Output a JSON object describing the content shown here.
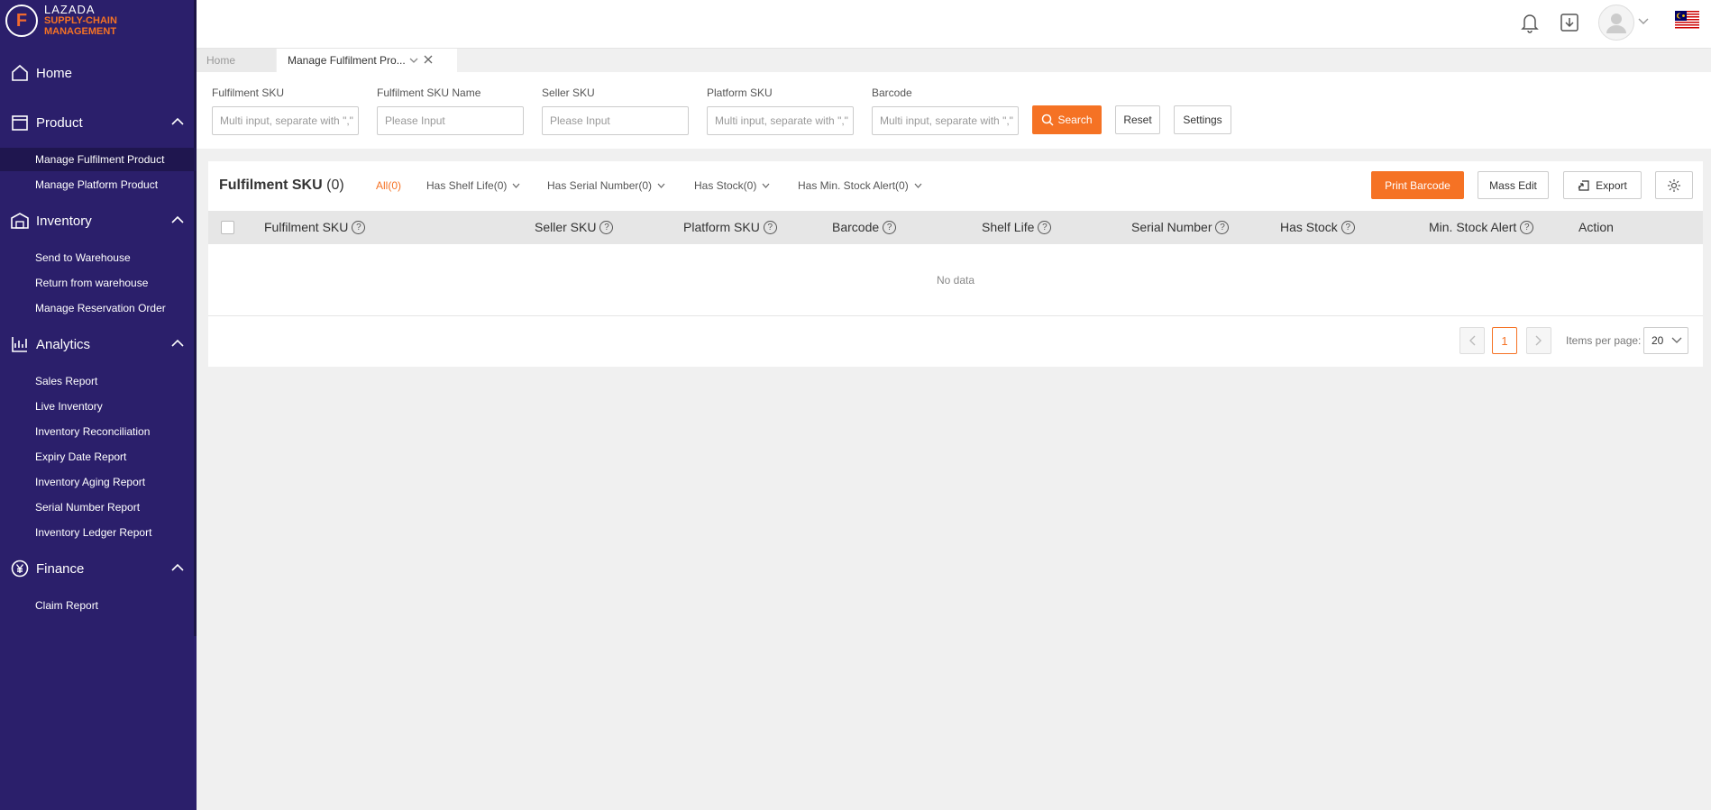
{
  "brand": {
    "line1": "LAZADA",
    "line2": "SUPPLY-CHAIN",
    "line3": "MANAGEMENT",
    "mark": "F",
    "accent": "#f57224"
  },
  "sidebar": {
    "home": "Home",
    "product": {
      "label": "Product",
      "items": [
        "Manage Fulfilment Product",
        "Manage Platform Product"
      ]
    },
    "inventory": {
      "label": "Inventory",
      "items": [
        "Send to Warehouse",
        "Return from warehouse",
        "Manage Reservation Order"
      ]
    },
    "analytics": {
      "label": "Analytics",
      "items": [
        "Sales Report",
        "Live Inventory",
        "Inventory Reconciliation",
        "Expiry Date Report",
        "Inventory Aging Report",
        "Serial Number Report",
        "Inventory Ledger Report"
      ]
    },
    "finance": {
      "label": "Finance",
      "items": [
        "Claim Report"
      ]
    }
  },
  "tabs": {
    "home": "Home",
    "current": "Manage Fulfilment Pro..."
  },
  "filters": {
    "fulfilment_sku": {
      "label": "Fulfilment SKU",
      "placeholder": "Multi input, separate with \",\""
    },
    "fulfilment_sku_name": {
      "label": "Fulfilment SKU Name",
      "placeholder": "Please Input"
    },
    "seller_sku": {
      "label": "Seller SKU",
      "placeholder": "Please Input"
    },
    "platform_sku": {
      "label": "Platform SKU",
      "placeholder": "Multi input, separate with \",\""
    },
    "barcode": {
      "label": "Barcode",
      "placeholder": "Multi input, separate with \",\""
    },
    "search": "Search",
    "reset": "Reset",
    "settings": "Settings"
  },
  "card": {
    "title": "Fulfilment SKU",
    "count": "(0)",
    "filter_tabs": [
      "All(0)",
      "Has Shelf Life(0)",
      "Has Serial Number(0)",
      "Has Stock(0)",
      "Has Min. Stock Alert(0)"
    ],
    "print_barcode": "Print Barcode",
    "mass_edit": "Mass Edit",
    "export": "Export"
  },
  "table": {
    "columns": [
      "Fulfilment SKU",
      "Seller SKU",
      "Platform SKU",
      "Barcode",
      "Shelf Life",
      "Serial Number",
      "Has Stock",
      "Min. Stock Alert",
      "Action"
    ],
    "empty": "No data",
    "help_mark": "?"
  },
  "pagination": {
    "current_page": "1",
    "items_per_page_label": "Items per page:",
    "items_per_page": "20"
  }
}
